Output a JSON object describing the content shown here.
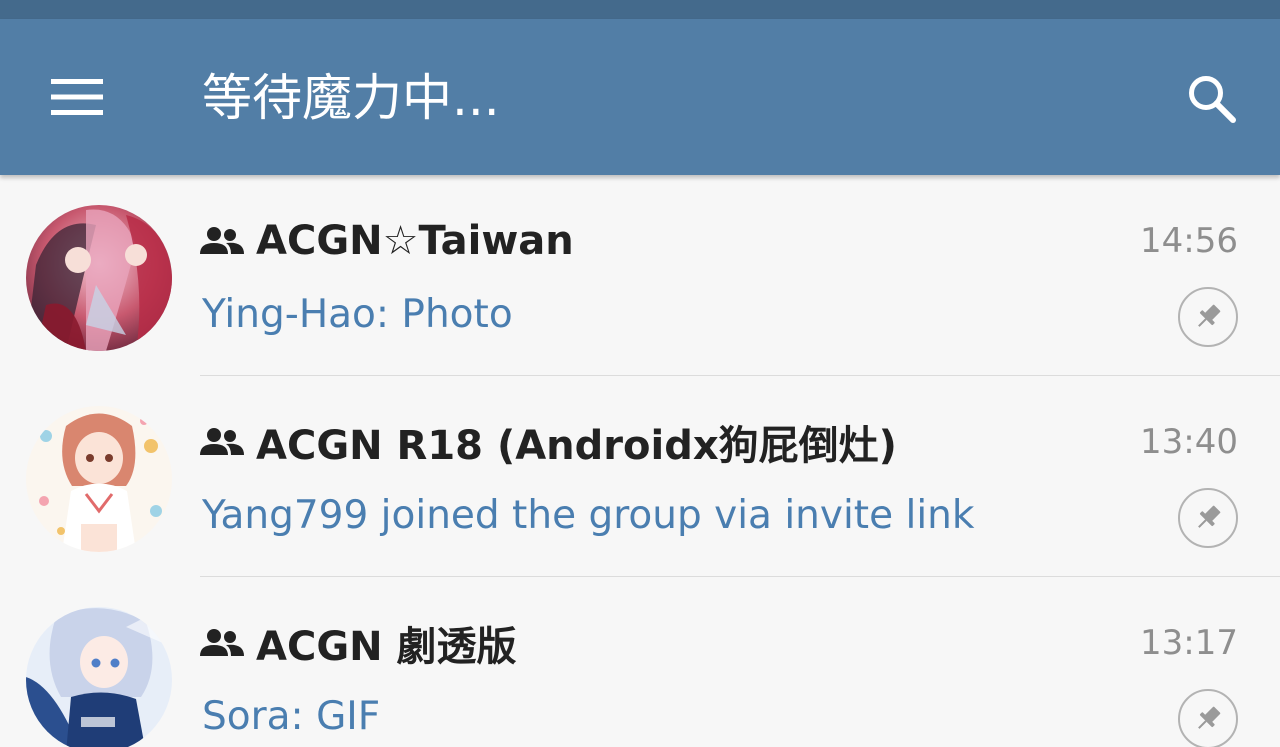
{
  "toolbar": {
    "title": "等待魔力中...",
    "menu_icon": "hamburger-menu-icon",
    "search_icon": "search-icon"
  },
  "colors": {
    "toolbar": "#527ea6",
    "status_bar": "#446a8c",
    "preview_text": "#4a7eb0",
    "background": "#f7f7f7"
  },
  "chats": [
    {
      "name": "ACGN☆Taiwan",
      "time": "14:56",
      "preview": "Ying-Hao: Photo",
      "type_icon": "group-icon",
      "pinned": true
    },
    {
      "name": "ACGN R18 (Androidx狗屁倒灶)",
      "time": "13:40",
      "preview": "Yang799 joined the group via invite link",
      "type_icon": "group-icon",
      "pinned": true
    },
    {
      "name": "ACGN 劇透版",
      "time": "13:17",
      "preview": "Sora: GIF",
      "type_icon": "group-icon",
      "pinned": true
    }
  ]
}
